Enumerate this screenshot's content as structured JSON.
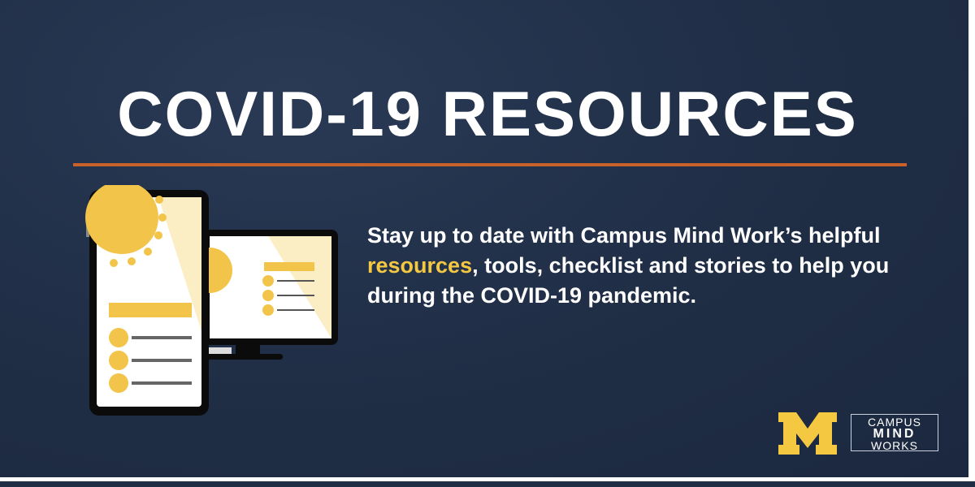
{
  "title": "COVID-19 RESOURCES",
  "body": {
    "before": "Stay up to date with Campus Mind Work’s helpful ",
    "highlight": "resources",
    "after": ", tools, checklist and stories to help you during the COVID-19 pandemic."
  },
  "logos": {
    "michigan": "M",
    "cmw_line1": "CAMPUS",
    "cmw_line2": "MIND",
    "cmw_line3": "WORKS"
  },
  "colors": {
    "background": "#1f2d45",
    "accent": "#c8622a",
    "highlight": "#f5c842"
  }
}
